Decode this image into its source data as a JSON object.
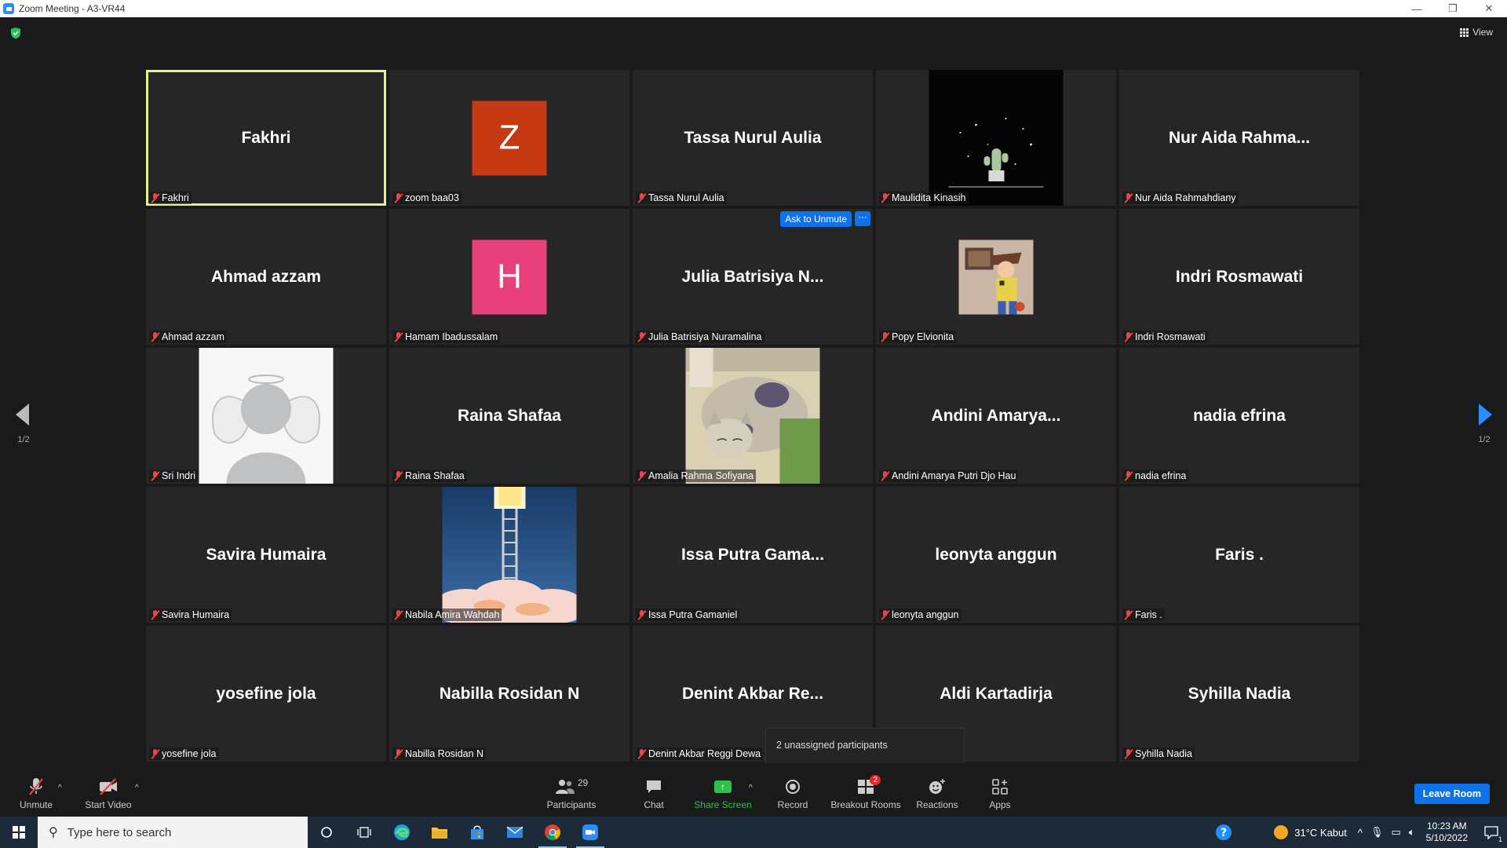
{
  "window": {
    "title": "Zoom Meeting - A3-VR44"
  },
  "header": {
    "view_label": "View"
  },
  "pager": {
    "left": "1/2",
    "right": "1/2"
  },
  "tiles": [
    {
      "big": "Fakhri",
      "label": "Fakhri",
      "kind": "name",
      "active": true
    },
    {
      "big": "Z",
      "label": "zoom baa03",
      "kind": "letter",
      "color": "#c53a12"
    },
    {
      "big": "Tassa Nurul Aulia",
      "label": "Tassa Nurul Aulia",
      "kind": "name"
    },
    {
      "big": "",
      "label": "Maulidita Kinasih",
      "kind": "pic-cactus"
    },
    {
      "big": "Nur Aida Rahma...",
      "label": "Nur Aida Rahmahdiany",
      "kind": "name"
    },
    {
      "big": "Ahmad azzam",
      "label": "Ahmad azzam",
      "kind": "name"
    },
    {
      "big": "H",
      "label": "Hamam Ibadussalam",
      "kind": "letter",
      "color": "#e8407a"
    },
    {
      "big": "Julia Batrisiya N...",
      "label": "Julia Batrisiya Nuramalina",
      "kind": "name",
      "ask": true
    },
    {
      "big": "",
      "label": "Popy Elvionita",
      "kind": "pic-woody"
    },
    {
      "big": "Indri Rosmawati",
      "label": "Indri Rosmawati",
      "kind": "name"
    },
    {
      "big": "",
      "label": "Sri Indri",
      "kind": "pic-angel"
    },
    {
      "big": "Raina Shafaa",
      "label": "Raina Shafaa",
      "kind": "name"
    },
    {
      "big": "",
      "label": "Amalia Rahma Sofiyana",
      "kind": "pic-cat"
    },
    {
      "big": "Andini  Amarya...",
      "label": "Andini Amarya Putri Djo Hau",
      "kind": "name"
    },
    {
      "big": "nadia efrina",
      "label": "nadia efrina",
      "kind": "name"
    },
    {
      "big": "Savira Humaira",
      "label": "Savira Humaira",
      "kind": "name"
    },
    {
      "big": "",
      "label": "Nabila Amira Wahdah",
      "kind": "pic-ladder"
    },
    {
      "big": "Issa Putra Gama...",
      "label": "Issa Putra Gamaniel",
      "kind": "name"
    },
    {
      "big": "leonyta anggun",
      "label": "leonyta anggun",
      "kind": "name"
    },
    {
      "big": "Faris .",
      "label": "Faris .",
      "kind": "name"
    },
    {
      "big": "yosefine jola",
      "label": "yosefine jola",
      "kind": "name"
    },
    {
      "big": "Nabilla Rosidan N",
      "label": "Nabilla Rosidan N",
      "kind": "name"
    },
    {
      "big": "Denint  Akbar  Re...",
      "label": "Denint Akbar Reggi Dewa",
      "kind": "name"
    },
    {
      "big": "Aldi Kartadirja",
      "label": "",
      "kind": "name"
    },
    {
      "big": "Syhilla Nadia",
      "label": "Syhilla Nadia",
      "kind": "name"
    }
  ],
  "tile_actions": {
    "ask_unmute": "Ask to Unmute",
    "more": "···"
  },
  "tooltip": {
    "text": "2 unassigned participants"
  },
  "toolbar": {
    "unmute": "Unmute",
    "start_video": "Start Video",
    "participants": "Participants",
    "participants_count": "29",
    "chat": "Chat",
    "share_screen": "Share Screen",
    "record": "Record",
    "breakout_rooms": "Breakout Rooms",
    "breakout_badge": "2",
    "reactions": "Reactions",
    "apps": "Apps",
    "leave": "Leave Room"
  },
  "taskbar": {
    "search_placeholder": "Type here to search",
    "weather": "31°C  Kabut",
    "time": "10:23 AM",
    "date": "5/10/2022",
    "notification_count": "1"
  },
  "colors": {
    "accent": "#0e72ed",
    "active_speaker": "#dff58a",
    "share_green": "#2cc24a",
    "muted_red": "#e44444"
  }
}
